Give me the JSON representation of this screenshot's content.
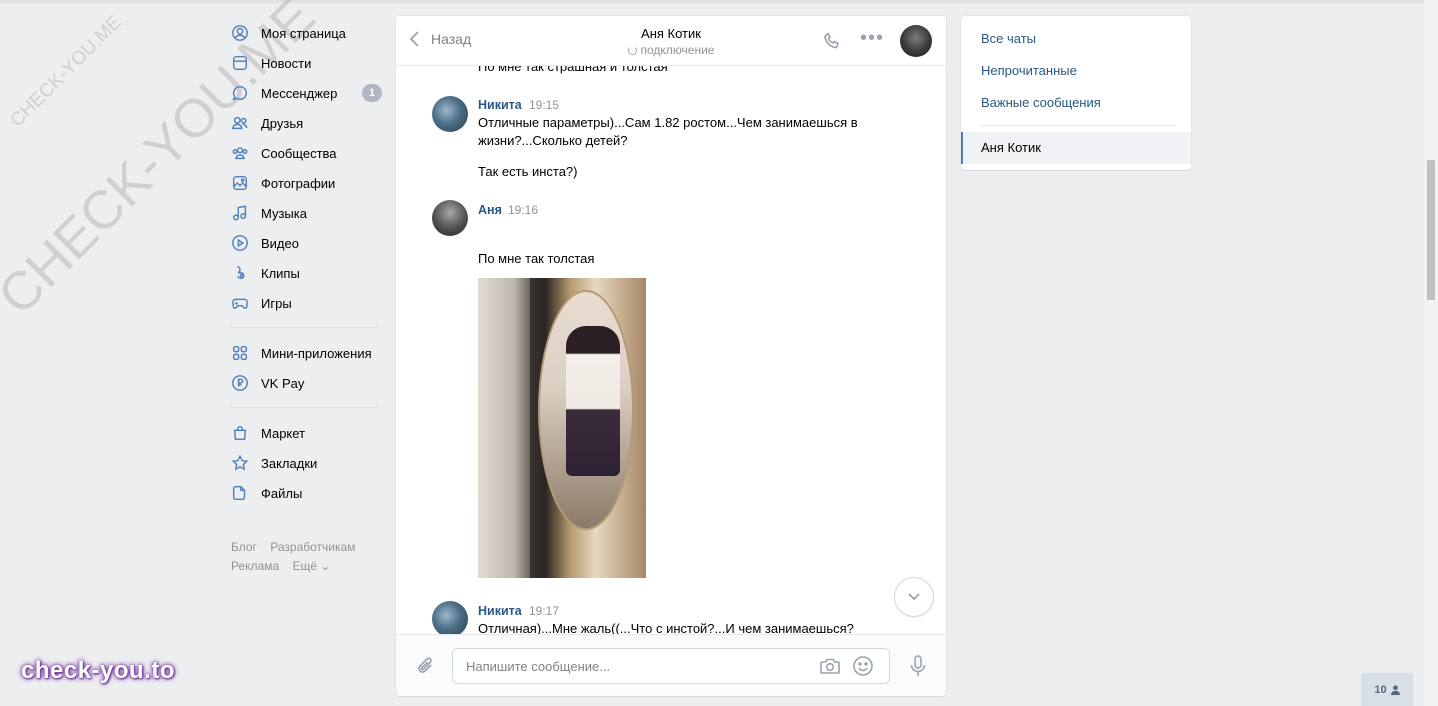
{
  "watermark": {
    "small": "CHECK-YOU.ME",
    "large": "CHECK-YOU.ME",
    "bottom": "check-you.to"
  },
  "nav": {
    "items": [
      {
        "label": "Моя страница",
        "icon": "user-circle-icon"
      },
      {
        "label": "Новости",
        "icon": "news-icon"
      },
      {
        "label": "Мессенджер",
        "icon": "message-icon",
        "badge": "1"
      },
      {
        "label": "Друзья",
        "icon": "friends-icon"
      },
      {
        "label": "Сообщества",
        "icon": "communities-icon"
      },
      {
        "label": "Фотографии",
        "icon": "photo-icon"
      },
      {
        "label": "Музыка",
        "icon": "music-icon"
      },
      {
        "label": "Видео",
        "icon": "video-icon"
      },
      {
        "label": "Клипы",
        "icon": "clips-icon"
      },
      {
        "label": "Игры",
        "icon": "games-icon"
      },
      {
        "label": "Мини-приложения",
        "icon": "apps-icon"
      },
      {
        "label": "VK Pay",
        "icon": "vkpay-icon"
      },
      {
        "label": "Маркет",
        "icon": "market-icon"
      },
      {
        "label": "Закладки",
        "icon": "star-icon"
      },
      {
        "label": "Файлы",
        "icon": "file-icon"
      }
    ],
    "footer": {
      "blog": "Блог",
      "dev": "Разработчикам",
      "ads": "Реклама",
      "more": "Ещё ⌄"
    }
  },
  "chat": {
    "back_label": "Назад",
    "title": "Аня Котик",
    "status": "подключение",
    "messages": {
      "cut_top": "По мне так страшная и толстая",
      "m1": {
        "author": "Никита",
        "time": "19:15",
        "text1": "Отличные параметры)...Сам 1.82 ростом...Чем занимаешься в жизни?...Сколько детей?",
        "text2": "Так есть инста?)"
      },
      "m2": {
        "author": "Аня",
        "time": "19:16",
        "text1": "По мне так толстая"
      },
      "m3": {
        "author": "Никита",
        "time": "19:17",
        "text1": "Отличная)...Мне жаль((...Что с инстой?...И чем занимаешься?"
      }
    },
    "composer_placeholder": "Напишите сообщение..."
  },
  "right": {
    "all_chats": "Все чаты",
    "unread": "Непрочитанные",
    "important": "Важные сообщения",
    "active_chat": "Аня Котик"
  },
  "online_count": "10",
  "colors": {
    "accent": "#5181b8",
    "link": "#2a5885",
    "background": "#edeef0"
  }
}
